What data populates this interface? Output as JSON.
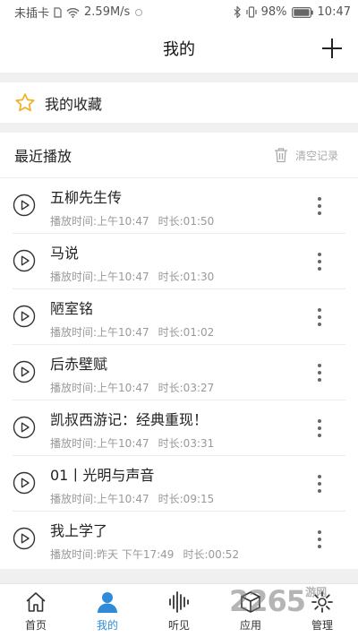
{
  "status_bar": {
    "carrier": "未插卡",
    "network_speed": "2.59M/s",
    "battery": "98%",
    "time": "10:47"
  },
  "header": {
    "title": "我的"
  },
  "favorites": {
    "label": "我的收藏"
  },
  "recent": {
    "title": "最近播放",
    "clear_label": "清空记录",
    "items": [
      {
        "title": "五柳先生传",
        "time": "播放时间:上午10:47",
        "duration": "时长:01:50"
      },
      {
        "title": "马说",
        "time": "播放时间:上午10:47",
        "duration": "时长:01:30"
      },
      {
        "title": "陋室铭",
        "time": "播放时间:上午10:47",
        "duration": "时长:01:02"
      },
      {
        "title": "后赤壁赋",
        "time": "播放时间:上午10:47",
        "duration": "时长:03:27"
      },
      {
        "title": "凯叔西游记：经典重现！",
        "time": "播放时间:上午10:47",
        "duration": "时长:03:31"
      },
      {
        "title": "01丨光明与声音",
        "time": "播放时间:上午10:47",
        "duration": "时长:09:15"
      },
      {
        "title": "我上学了",
        "time": "播放时间:昨天 下午17:49",
        "duration": "时长:00:52"
      }
    ]
  },
  "tabbar": {
    "items": [
      {
        "label": "首页",
        "icon": "home-icon"
      },
      {
        "label": "我的",
        "icon": "user-icon",
        "active": true
      },
      {
        "label": "听见",
        "icon": "sound-wave-icon"
      },
      {
        "label": "应用",
        "icon": "box-icon"
      },
      {
        "label": "管理",
        "icon": "gear-icon"
      }
    ]
  },
  "watermark": {
    "text": "2265",
    "suffix": "游网"
  },
  "colors": {
    "accent": "#2f8bd8",
    "star": "#f2b01e"
  }
}
